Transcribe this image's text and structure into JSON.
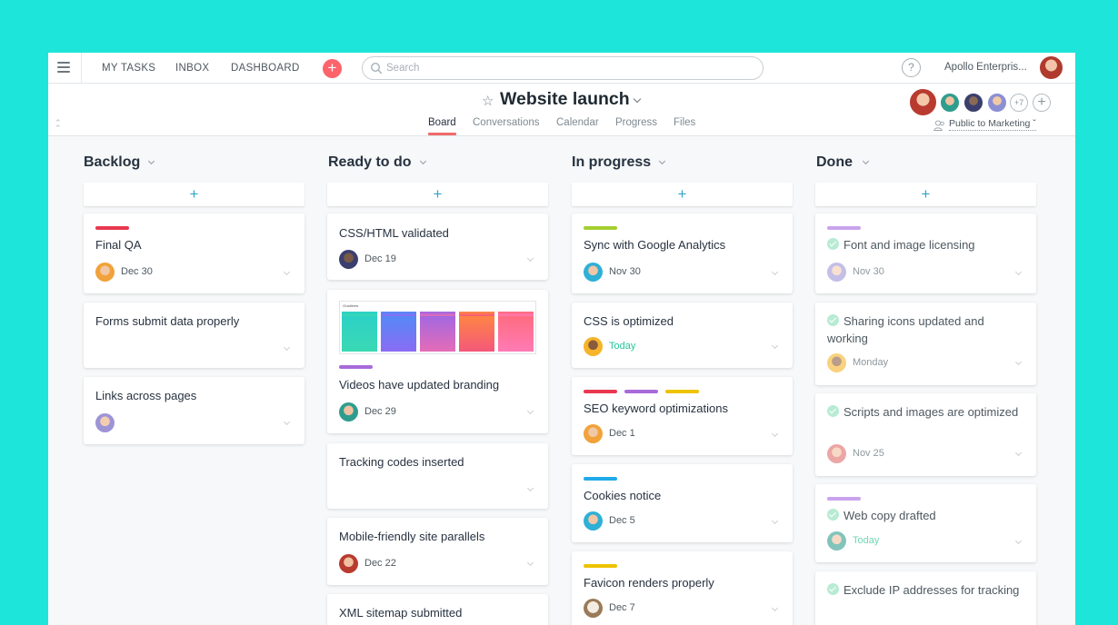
{
  "topbar": {
    "nav": [
      "MY TASKS",
      "INBOX",
      "DASHBOARD"
    ],
    "add_label": "+",
    "search_placeholder": "Search",
    "help_label": "?",
    "org_name": "Apollo Enterpris..."
  },
  "project": {
    "title": "Website launch",
    "tabs": [
      "Board",
      "Conversations",
      "Calendar",
      "Progress",
      "Files"
    ],
    "active_tab": "Board",
    "members_more": "+7",
    "privacy": "Public to Marketing"
  },
  "colors": {
    "accent_red": "#fc636b",
    "tab_underline": "#f06a6a",
    "add_plus": "#2fa6c9",
    "today_green": "#25c59a"
  },
  "columns": [
    {
      "title": "Backlog",
      "add_label": "+",
      "cards": [
        {
          "name": "Final QA",
          "tags": [
            "#e8384f"
          ],
          "due": "Dec 30",
          "avatar": "face-orange"
        },
        {
          "name": "Forms submit data properly",
          "tags": [],
          "due": "",
          "avatar": ""
        },
        {
          "name": "Links across pages",
          "tags": [],
          "due": "",
          "avatar": "face-purple"
        }
      ]
    },
    {
      "title": "Ready to do",
      "add_label": "+",
      "cards": [
        {
          "name": "CSS/HTML validated",
          "tags": [],
          "due": "Dec 19",
          "avatar": "face-dark"
        },
        {
          "name": "Videos have updated branding",
          "tags": [
            "#a86bd9"
          ],
          "due": "Dec 29",
          "avatar": "face-teal",
          "thumbnail_caption": "Gradients"
        },
        {
          "name": "Tracking codes inserted",
          "tags": [],
          "due": "",
          "avatar": ""
        },
        {
          "name": "Mobile-friendly site parallels",
          "tags": [],
          "due": "Dec 22",
          "avatar": "face-red"
        },
        {
          "name": "XML sitemap submitted",
          "tags": [],
          "due": "",
          "avatar": ""
        }
      ]
    },
    {
      "title": "In progress",
      "add_label": "+",
      "cards": [
        {
          "name": "Sync with Google Analytics",
          "tags": [
            "#a4cf30"
          ],
          "due": "Nov 30",
          "avatar": "face-blue"
        },
        {
          "name": "CSS is optimized",
          "tags": [],
          "due": "Today",
          "due_today": true,
          "avatar": "face-yellow"
        },
        {
          "name": "SEO keyword optimizations",
          "tags": [
            "#e8384f",
            "#a86bd9",
            "#eec300"
          ],
          "due": "Dec 1",
          "avatar": "face-orange"
        },
        {
          "name": "Cookies notice",
          "tags": [
            "#20aaea"
          ],
          "due": "Dec 5",
          "avatar": "face-blue"
        },
        {
          "name": "Favicon renders properly",
          "tags": [
            "#eec300"
          ],
          "due": "Dec 7",
          "avatar": "face-dog"
        }
      ]
    },
    {
      "title": "Done",
      "add_label": "+",
      "cards": [
        {
          "name": "Font and image licensing",
          "tags": [
            "#c9a3ec"
          ],
          "due": "Nov 30",
          "avatar": "face-purple"
        },
        {
          "name": "Sharing icons updated and working",
          "tags": [],
          "due": "Monday",
          "avatar": "face-yellow"
        },
        {
          "name": "Scripts and images are optimized",
          "tags": [],
          "due": "Nov 25",
          "avatar": "face-red"
        },
        {
          "name": "Web copy drafted",
          "tags": [
            "#c9a3ec"
          ],
          "due": "Today",
          "due_today": true,
          "avatar": "face-teal"
        },
        {
          "name": "Exclude IP addresses for tracking",
          "tags": [],
          "due": "",
          "avatar": ""
        }
      ]
    }
  ]
}
